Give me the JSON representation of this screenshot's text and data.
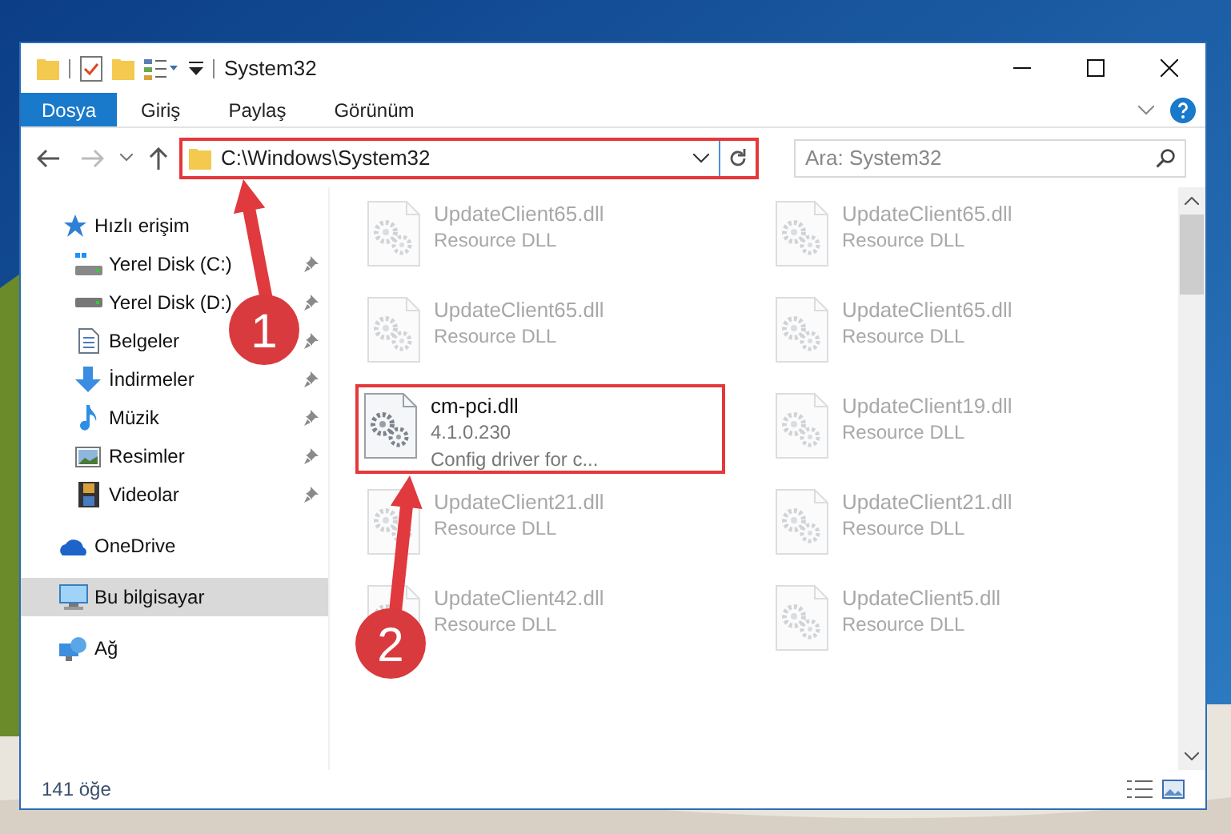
{
  "window": {
    "title": "System32"
  },
  "ribbon_tabs": [
    {
      "label": "Dosya",
      "selected": true
    },
    {
      "label": "Giriş",
      "selected": false
    },
    {
      "label": "Paylaş",
      "selected": false
    },
    {
      "label": "Görünüm",
      "selected": false
    }
  ],
  "address": {
    "path": "C:\\Windows\\System32",
    "highlighted": true
  },
  "search": {
    "placeholder": "Ara: System32"
  },
  "navigation": [
    {
      "label": "Hızlı erişim",
      "selected": false,
      "children": [
        {
          "label": "Yerel Disk (C:)",
          "pinned": true
        },
        {
          "label": "Yerel Disk (D:)",
          "pinned": true
        },
        {
          "label": "Belgeler",
          "pinned": true
        },
        {
          "label": "İndirmeler",
          "pinned": true
        },
        {
          "label": "Müzik",
          "pinned": true
        },
        {
          "label": "Resimler",
          "pinned": true
        },
        {
          "label": "Videolar",
          "pinned": true
        }
      ]
    },
    {
      "label": "OneDrive",
      "selected": false
    },
    {
      "label": "Bu bilgisayar",
      "selected": true
    },
    {
      "label": "Ağ",
      "selected": false
    }
  ],
  "files": [
    {
      "name": "UpdateClient65.dll",
      "lines": [
        "Resource DLL"
      ],
      "faded": true,
      "highlighted": false
    },
    {
      "name": "UpdateClient65.dll",
      "lines": [
        "Resource DLL"
      ],
      "faded": true,
      "highlighted": false
    },
    {
      "name": "UpdateClient65.dll",
      "lines": [
        "Resource DLL"
      ],
      "faded": true,
      "highlighted": false
    },
    {
      "name": "UpdateClient65.dll",
      "lines": [
        "Resource DLL"
      ],
      "faded": true,
      "highlighted": false
    },
    {
      "name": "cm-pci.dll",
      "lines": [
        "4.1.0.230",
        "Config driver for c..."
      ],
      "faded": false,
      "highlighted": true
    },
    {
      "name": "UpdateClient19.dll",
      "lines": [
        "Resource DLL"
      ],
      "faded": true,
      "highlighted": false
    },
    {
      "name": "UpdateClient21.dll",
      "lines": [
        "Resource DLL"
      ],
      "faded": true,
      "highlighted": false
    },
    {
      "name": "UpdateClient21.dll",
      "lines": [
        "Resource DLL"
      ],
      "faded": true,
      "highlighted": false
    },
    {
      "name": "UpdateClient42.dll",
      "lines": [
        "Resource DLL"
      ],
      "faded": true,
      "highlighted": false
    },
    {
      "name": "UpdateClient5.dll",
      "lines": [
        "Resource DLL"
      ],
      "faded": true,
      "highlighted": false
    }
  ],
  "status_bar": {
    "item_count": "141 öğe"
  },
  "annotations": [
    {
      "label": "1"
    },
    {
      "label": "2"
    }
  ]
}
